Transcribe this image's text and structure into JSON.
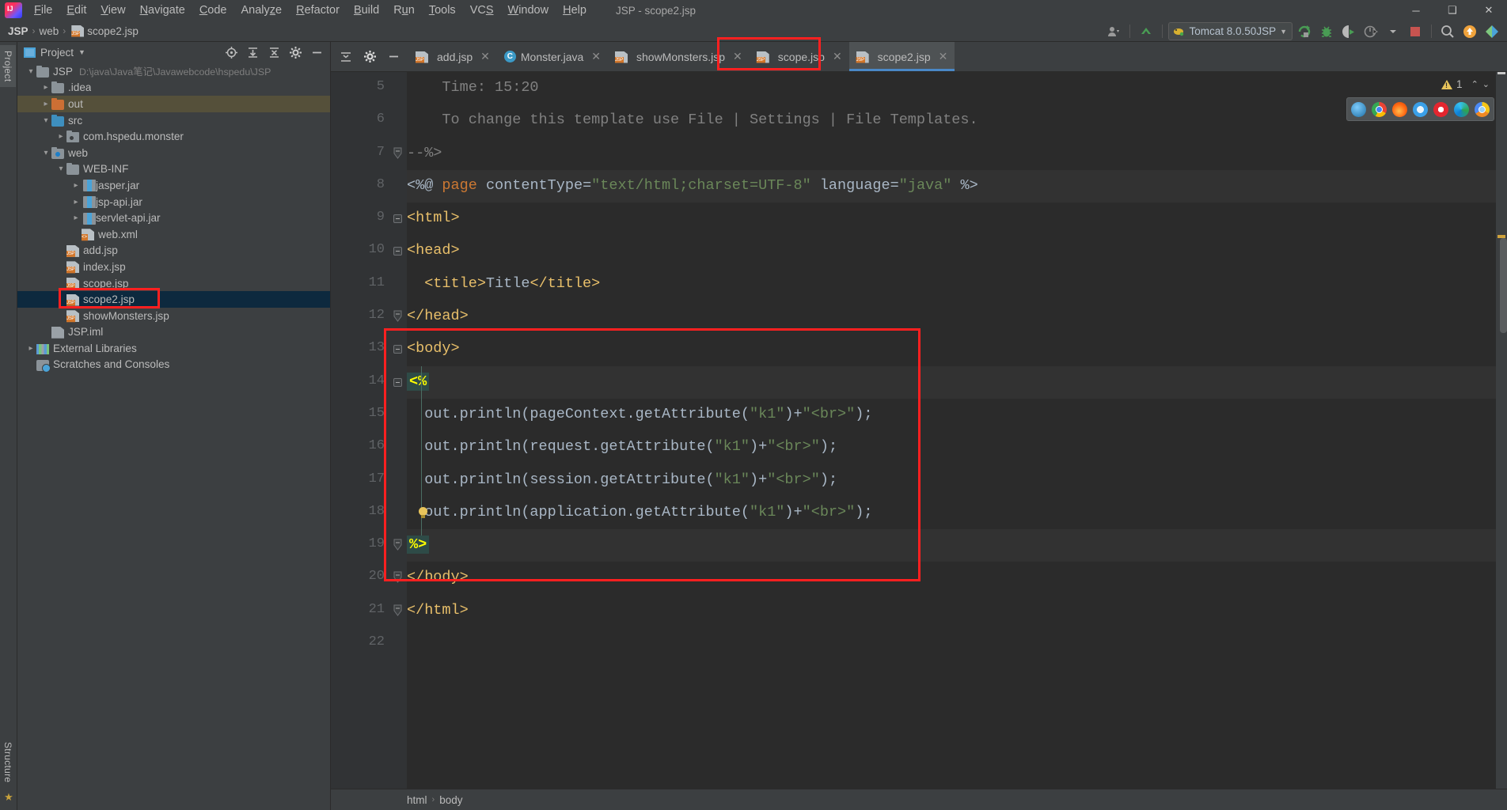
{
  "window": {
    "title": "JSP - scope2.jsp",
    "minimize": "─",
    "maximize": "❑",
    "close": "✕"
  },
  "menu": [
    {
      "label": "File",
      "mnemonic": "F"
    },
    {
      "label": "Edit",
      "mnemonic": "E"
    },
    {
      "label": "View",
      "mnemonic": "V"
    },
    {
      "label": "Navigate",
      "mnemonic": "N"
    },
    {
      "label": "Code",
      "mnemonic": "C"
    },
    {
      "label": "Analyze",
      "mnemonic": "z"
    },
    {
      "label": "Refactor",
      "mnemonic": "R"
    },
    {
      "label": "Build",
      "mnemonic": "B"
    },
    {
      "label": "Run",
      "mnemonic": "u"
    },
    {
      "label": "Tools",
      "mnemonic": "T"
    },
    {
      "label": "VCS",
      "mnemonic": "S"
    },
    {
      "label": "Window",
      "mnemonic": "W"
    },
    {
      "label": "Help",
      "mnemonic": "H"
    }
  ],
  "breadcrumb": {
    "project": "JSP",
    "folder": "web",
    "file": "scope2.jsp",
    "separator": "›"
  },
  "toolbar": {
    "avatar_label": "user-avatar",
    "run_config": "Tomcat 8.0.50JSP",
    "icons": [
      "user-avatar-icon",
      "vcs-update-icon",
      "run-icon",
      "debug-icon",
      "run-with-coverage-icon",
      "profiler-icon",
      "stop-icon",
      "search-everywhere-icon",
      "update-project-icon"
    ]
  },
  "stripes": {
    "left_top": "Project",
    "left_bottom_1": "Structure",
    "left_bottom_2": "Favorites"
  },
  "project_panel": {
    "title": "Project",
    "actions": [
      "locate-icon",
      "expand-all-icon",
      "collapse-all-icon",
      "settings-icon",
      "hide-icon"
    ],
    "tree": [
      {
        "label": "JSP",
        "sub": "D:\\java\\Java笔记\\Javawebcode\\hspedu\\JSP",
        "depth": 0,
        "arrow": "down",
        "icon": "project-folder",
        "state": "normal"
      },
      {
        "label": ".idea",
        "sub": "",
        "depth": 1,
        "arrow": "right",
        "icon": "folder",
        "state": "normal"
      },
      {
        "label": "out",
        "sub": "",
        "depth": 1,
        "arrow": "right",
        "icon": "folder-excluded",
        "state": "highlight"
      },
      {
        "label": "src",
        "sub": "",
        "depth": 1,
        "arrow": "down",
        "icon": "folder-source",
        "state": "normal"
      },
      {
        "label": "com.hspedu.monster",
        "sub": "",
        "depth": 2,
        "arrow": "right",
        "icon": "package",
        "state": "normal"
      },
      {
        "label": "web",
        "sub": "",
        "depth": 1,
        "arrow": "down",
        "icon": "folder-web",
        "state": "normal"
      },
      {
        "label": "WEB-INF",
        "sub": "",
        "depth": 2,
        "arrow": "down",
        "icon": "folder",
        "state": "normal"
      },
      {
        "label": "jasper.jar",
        "sub": "",
        "depth": 3,
        "arrow": "right",
        "icon": "jar",
        "state": "normal"
      },
      {
        "label": "jsp-api.jar",
        "sub": "",
        "depth": 3,
        "arrow": "right",
        "icon": "jar",
        "state": "normal"
      },
      {
        "label": "servlet-api.jar",
        "sub": "",
        "depth": 3,
        "arrow": "right",
        "icon": "jar",
        "state": "normal"
      },
      {
        "label": "web.xml",
        "sub": "",
        "depth": 3,
        "arrow": "none",
        "icon": "xml",
        "state": "normal"
      },
      {
        "label": "add.jsp",
        "sub": "",
        "depth": 2,
        "arrow": "none",
        "icon": "jsp",
        "state": "normal"
      },
      {
        "label": "index.jsp",
        "sub": "",
        "depth": 2,
        "arrow": "none",
        "icon": "jsp",
        "state": "normal"
      },
      {
        "label": "scope.jsp",
        "sub": "",
        "depth": 2,
        "arrow": "none",
        "icon": "jsp",
        "state": "normal"
      },
      {
        "label": "scope2.jsp",
        "sub": "",
        "depth": 2,
        "arrow": "none",
        "icon": "jsp",
        "state": "selected"
      },
      {
        "label": "showMonsters.jsp",
        "sub": "",
        "depth": 2,
        "arrow": "none",
        "icon": "jsp",
        "state": "normal"
      },
      {
        "label": "JSP.iml",
        "sub": "",
        "depth": 1,
        "arrow": "none",
        "icon": "iml",
        "state": "normal"
      },
      {
        "label": "External Libraries",
        "sub": "",
        "depth": 0,
        "arrow": "right",
        "icon": "library",
        "state": "normal"
      },
      {
        "label": "Scratches and Consoles",
        "sub": "",
        "depth": 0,
        "arrow": "none",
        "icon": "scratch",
        "state": "normal"
      }
    ]
  },
  "editor": {
    "tabs": [
      {
        "label": "add.jsp",
        "icon": "jsp",
        "active": false
      },
      {
        "label": "Monster.java",
        "icon": "java-class",
        "active": false
      },
      {
        "label": "showMonsters.jsp",
        "icon": "jsp",
        "active": false
      },
      {
        "label": "scope.jsp",
        "icon": "jsp",
        "active": false
      },
      {
        "label": "scope2.jsp",
        "icon": "jsp",
        "active": true
      }
    ],
    "close_glyph": "✕",
    "inspection": {
      "warning_count": "1",
      "collapse": "⌃",
      "expand": "⌄"
    },
    "browsers": [
      "ie-browser-icon",
      "chrome-browser-icon",
      "firefox-browser-icon",
      "safari-browser-icon",
      "opera-browser-icon",
      "edge-browser-icon",
      "chrome-canary-browser-icon"
    ],
    "first_line_number": 5,
    "lines": [
      {
        "n": 5,
        "fold": "none",
        "highlight": false,
        "html": "<span class=\"s-comment\">    Time: 15:20</span>"
      },
      {
        "n": 6,
        "fold": "none",
        "highlight": false,
        "html": "<span class=\"s-comment\">    To change this template use File | Settings | File Templates.</span>"
      },
      {
        "n": 7,
        "fold": "end",
        "highlight": false,
        "html": "<span class=\"s-comment\">--%&gt;</span>"
      },
      {
        "n": 8,
        "fold": "none",
        "highlight": true,
        "html": "<span class=\"s-plain\">&lt;%@ </span><span class=\"s-kw\">page</span><span class=\"s-plain\"> contentType=</span><span class=\"s-str\">\"text/html;charset=UTF-8\"</span><span class=\"s-plain\"> language=</span><span class=\"s-str\">\"java\"</span><span class=\"s-plain\"> %&gt;</span>"
      },
      {
        "n": 9,
        "fold": "start",
        "highlight": false,
        "html": "<span class=\"s-tag\">&lt;html&gt;</span>"
      },
      {
        "n": 10,
        "fold": "start",
        "highlight": false,
        "html": "<span class=\"s-tag\">&lt;head&gt;</span>"
      },
      {
        "n": 11,
        "fold": "none",
        "highlight": false,
        "html": "<span class=\"s-tag\">  &lt;title&gt;</span><span class=\"s-plain\">Title</span><span class=\"s-tag\">&lt;/title&gt;</span>"
      },
      {
        "n": 12,
        "fold": "end",
        "highlight": false,
        "html": "<span class=\"s-tag\">&lt;/head&gt;</span>"
      },
      {
        "n": 13,
        "fold": "start",
        "highlight": false,
        "html": "<span class=\"s-tag\">&lt;body&gt;</span>"
      },
      {
        "n": 14,
        "fold": "start",
        "highlight": true,
        "html": "<span class=\"s-jspdelim\">&lt;%</span>"
      },
      {
        "n": 15,
        "fold": "none",
        "highlight": false,
        "html": "<span class=\"s-plain\">  out.println(pageContext.getAttribute(</span><span class=\"s-str\">\"k1\"</span><span class=\"s-plain\">)+</span><span class=\"s-str\">\"&lt;br&gt;\"</span><span class=\"s-plain\">);</span>"
      },
      {
        "n": 16,
        "fold": "none",
        "highlight": false,
        "html": "<span class=\"s-plain\">  out.println(request.getAttribute(</span><span class=\"s-str\">\"k1\"</span><span class=\"s-plain\">)+</span><span class=\"s-str\">\"&lt;br&gt;\"</span><span class=\"s-plain\">);</span>"
      },
      {
        "n": 17,
        "fold": "none",
        "highlight": false,
        "html": "<span class=\"s-plain\">  out.println(session.getAttribute(</span><span class=\"s-str\">\"k1\"</span><span class=\"s-plain\">)+</span><span class=\"s-str\">\"&lt;br&gt;\"</span><span class=\"s-plain\">);</span>"
      },
      {
        "n": 18,
        "fold": "none",
        "highlight": false,
        "html": "<span class=\"s-plain\">  out.println(application.getAttribute(</span><span class=\"s-str\">\"k1\"</span><span class=\"s-plain\">)+</span><span class=\"s-str\">\"&lt;br&gt;\"</span><span class=\"s-plain\">);</span>"
      },
      {
        "n": 19,
        "fold": "end",
        "highlight": true,
        "html": "<span class=\"s-jspdelim\">%&gt;</span>"
      },
      {
        "n": 20,
        "fold": "end",
        "highlight": false,
        "html": "<span class=\"s-tag\">&lt;/body&gt;</span>"
      },
      {
        "n": 21,
        "fold": "end",
        "highlight": false,
        "html": "<span class=\"s-tag\">&lt;/html&gt;</span>"
      },
      {
        "n": 22,
        "fold": "none",
        "highlight": false,
        "html": ""
      }
    ],
    "bottom_breadcrumb": [
      "html",
      "body"
    ],
    "bottom_separator": "›"
  },
  "colors": {
    "accent_blue": "#4a88c7",
    "annotation_red": "#fe2020",
    "selection_blue": "#0d293e",
    "editor_bg": "#2b2b2b",
    "panel_bg": "#3c3f41",
    "string_green": "#6a8759",
    "keyword_orange": "#cc7832",
    "tag_yellow": "#e8bf6a",
    "jsp_delim_yellow": "#ffff00"
  }
}
